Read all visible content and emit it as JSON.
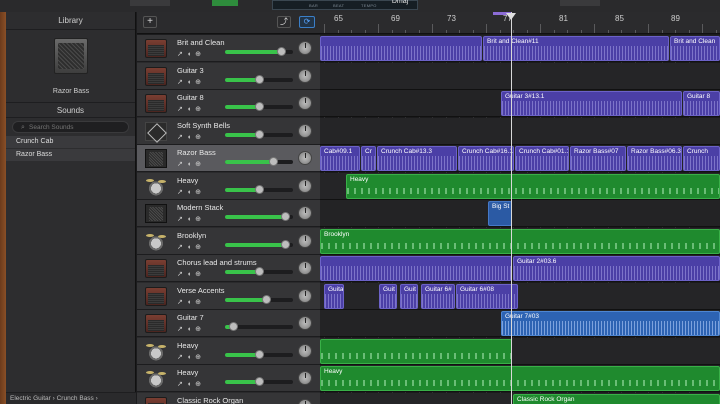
{
  "transport": {
    "lcd_labels": [
      "BAR",
      "BEAT",
      "TEMPO"
    ],
    "key": "Dmaj"
  },
  "library": {
    "title": "Library",
    "selected_amp": "Razor Bass",
    "sounds_title": "Sounds",
    "search_placeholder": "Search Sounds",
    "sounds": [
      "Crunch Cab",
      "Razor Bass"
    ],
    "breadcrumb": "Electric Guitar › Crunch Bass ›"
  },
  "ruler": {
    "bars": [
      "65",
      "69",
      "73",
      "77",
      "81",
      "85",
      "89"
    ]
  },
  "tracks": [
    {
      "name": "Brit and Clean",
      "icon": "amp-icon",
      "volume": 0.82,
      "selected": false,
      "regions": [
        {
          "label": "",
          "color": "purple",
          "start": 0,
          "end": 162
        },
        {
          "label": "Brit and Clean#11",
          "color": "purple",
          "start": 163,
          "end": 349
        },
        {
          "label": "Brit and Clean",
          "color": "purple",
          "start": 350,
          "end": 400
        }
      ]
    },
    {
      "name": "Guitar 3",
      "icon": "amp-icon",
      "volume": 0.5,
      "selected": false,
      "regions": []
    },
    {
      "name": "Guitar 8",
      "icon": "amp-icon",
      "volume": 0.5,
      "selected": false,
      "regions": [
        {
          "label": "Guitar 3#13.1",
          "color": "purple",
          "start": 181,
          "end": 362
        },
        {
          "label": "Guitar 8",
          "color": "purple",
          "start": 363,
          "end": 400
        }
      ]
    },
    {
      "name": "Soft Synth Bells",
      "icon": "synth-icon",
      "volume": 0.5,
      "selected": false,
      "regions": []
    },
    {
      "name": "Razor Bass",
      "icon": "cab-icon",
      "volume": 0.7,
      "selected": true,
      "regions": [
        {
          "label": "Cab#09.1",
          "color": "purple",
          "start": 0,
          "end": 40
        },
        {
          "label": "Cr",
          "color": "purple",
          "start": 41,
          "end": 56
        },
        {
          "label": "Crunch Cab#13.3",
          "color": "purple",
          "start": 57,
          "end": 137
        },
        {
          "label": "Crunch Cab#16.1",
          "color": "purple",
          "start": 138,
          "end": 194
        },
        {
          "label": "Crunch Cab#01.1",
          "color": "purple",
          "start": 195,
          "end": 249
        },
        {
          "label": "Razor Bass#07",
          "color": "purple",
          "start": 250,
          "end": 306
        },
        {
          "label": "Razor Bass#06.3",
          "color": "purple",
          "start": 307,
          "end": 362
        },
        {
          "label": "Crunch",
          "color": "purple",
          "start": 363,
          "end": 400
        }
      ]
    },
    {
      "name": "Heavy",
      "icon": "drums-icon",
      "volume": 0.5,
      "selected": false,
      "regions": [
        {
          "label": "Heavy",
          "color": "green",
          "start": 26,
          "end": 400
        }
      ]
    },
    {
      "name": "Modern Stack",
      "icon": "cab-icon",
      "volume": 0.88,
      "selected": false,
      "regions": [
        {
          "label": "Big St",
          "color": "darkblue",
          "start": 168,
          "end": 192
        }
      ]
    },
    {
      "name": "Brooklyn",
      "icon": "drums-icon",
      "volume": 0.88,
      "selected": false,
      "regions": [
        {
          "label": "Brooklyn",
          "color": "green",
          "start": 0,
          "end": 400
        }
      ]
    },
    {
      "name": "Chorus lead and strums",
      "icon": "amp-icon",
      "volume": 0.5,
      "selected": false,
      "regions": [
        {
          "label": "",
          "color": "purple",
          "start": 0,
          "end": 192
        },
        {
          "label": "Guitar 2#03.6",
          "color": "purple",
          "start": 193,
          "end": 400
        }
      ]
    },
    {
      "name": "Verse Accents",
      "icon": "amp-icon",
      "volume": 0.6,
      "selected": false,
      "regions": [
        {
          "label": "Guita",
          "color": "purple",
          "start": 4,
          "end": 24
        },
        {
          "label": "Guit",
          "color": "purple",
          "start": 59,
          "end": 77
        },
        {
          "label": "Guit",
          "color": "purple",
          "start": 80,
          "end": 98
        },
        {
          "label": "Guitar 6#",
          "color": "purple",
          "start": 101,
          "end": 135
        },
        {
          "label": "Guitar 6#08",
          "color": "purple",
          "start": 136,
          "end": 198
        }
      ]
    },
    {
      "name": "Guitar 7",
      "icon": "amp-icon",
      "volume": 0.12,
      "selected": false,
      "regions": [
        {
          "label": "Guitar 7#03",
          "color": "blue",
          "start": 181,
          "end": 400
        }
      ]
    },
    {
      "name": "Heavy",
      "icon": "drums-icon",
      "volume": 0.5,
      "selected": false,
      "regions": [
        {
          "label": "",
          "color": "green",
          "start": 0,
          "end": 192
        }
      ]
    },
    {
      "name": "Heavy",
      "icon": "drums-icon",
      "volume": 0.5,
      "selected": false,
      "regions": [
        {
          "label": "Heavy",
          "color": "green",
          "start": 0,
          "end": 400
        }
      ]
    },
    {
      "name": "Classic Rock Organ",
      "icon": "amp-icon",
      "volume": 0.5,
      "selected": false,
      "regions": [
        {
          "label": "Classic Rock Organ",
          "color": "green",
          "start": 193,
          "end": 400
        }
      ]
    }
  ]
}
